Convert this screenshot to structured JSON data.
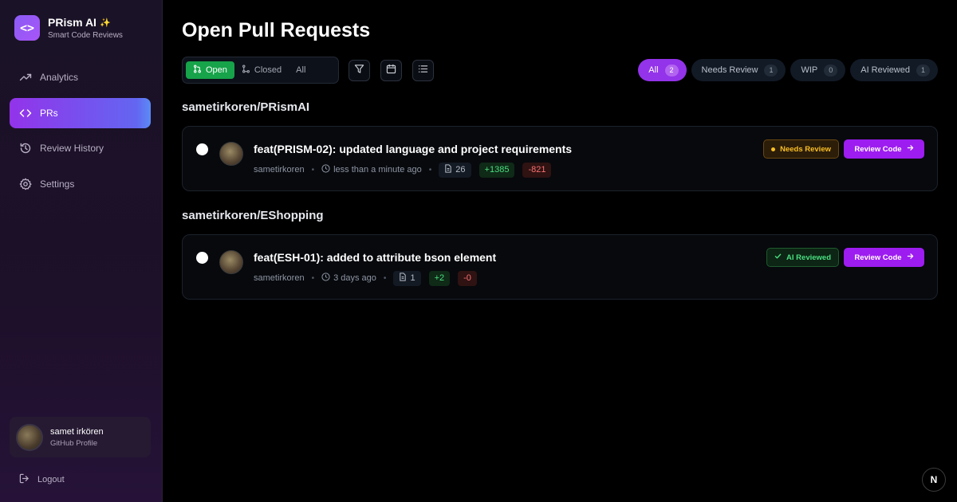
{
  "brand": {
    "name": "PRism AI",
    "sparkle": "✨",
    "subtitle": "Smart Code Reviews",
    "logo": "<>"
  },
  "sidebar": {
    "items": [
      {
        "label": "Analytics",
        "icon": "trending-up-icon",
        "active": false
      },
      {
        "label": "PRs",
        "icon": "code-icon",
        "active": true
      },
      {
        "label": "Review History",
        "icon": "history-icon",
        "active": false
      },
      {
        "label": "Settings",
        "icon": "gear-icon",
        "active": false
      }
    ],
    "profile": {
      "name": "samet irkören",
      "subtitle": "GitHub Profile"
    },
    "logout": "Logout"
  },
  "main": {
    "title": "Open Pull Requests",
    "state_tabs": [
      {
        "label": "Open",
        "active": true
      },
      {
        "label": "Closed",
        "active": false
      },
      {
        "label": "All",
        "active": false
      }
    ],
    "filters": [
      {
        "label": "All",
        "count": "2",
        "active": true
      },
      {
        "label": "Needs Review",
        "count": "1",
        "active": false
      },
      {
        "label": "WIP",
        "count": "0",
        "active": false
      },
      {
        "label": "AI Reviewed",
        "count": "1",
        "active": false
      }
    ],
    "groups": [
      {
        "repo": "sametirkoren/PRismAI",
        "prs": [
          {
            "title": "feat(PRISM-02): updated language and project requirements",
            "author": "sametirkoren",
            "time": "less than a minute ago",
            "files": "26",
            "additions": "+1385",
            "deletions": "-821",
            "status": "Needs Review",
            "action": "Review Code"
          }
        ]
      },
      {
        "repo": "sametirkoren/EShopping",
        "prs": [
          {
            "title": "feat(ESH-01): added to attribute bson element",
            "author": "sametirkoren",
            "time": "3 days ago",
            "files": "1",
            "additions": "+2",
            "deletions": "-0",
            "status": "AI Reviewed",
            "action": "Review Code"
          }
        ]
      }
    ]
  },
  "next_badge": "N",
  "colors": {
    "accent": "#9333ea",
    "open": "#16a34a",
    "additions": "#4ade80",
    "deletions": "#f87171",
    "warning": "#fbbf24"
  }
}
